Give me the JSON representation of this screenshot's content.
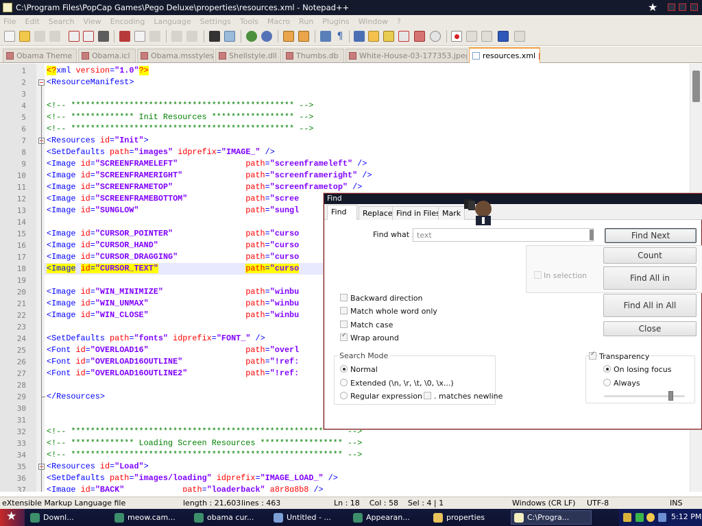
{
  "window": {
    "title": "C:\\Program Files\\PopCap Games\\Pego Deluxe\\properties\\resources.xml - Notepad++"
  },
  "menu": [
    "File",
    "Edit",
    "Search",
    "View",
    "Encoding",
    "Language",
    "Settings",
    "Tools",
    "Macro",
    "Run",
    "Plugins",
    "Window",
    "?"
  ],
  "tabs": [
    "Obama Theme",
    "Obama.icl",
    "Obama.msstyles",
    "Shellstyle.dll",
    "Thumbs.db",
    "White-House-03-177353.jpeg",
    "resources.xml"
  ],
  "active_tab": "resources.xml",
  "editor": {
    "lines": [
      {
        "n": "1",
        "segs": [
          [
            "pi",
            "<?"
          ],
          [
            "tag",
            "xml "
          ],
          [
            "attr",
            "version"
          ],
          [
            "tag",
            "="
          ],
          [
            "val",
            "\"1.0\""
          ],
          [
            "pi",
            "?>"
          ]
        ]
      },
      {
        "n": "2",
        "segs": [
          [
            "tag",
            "<ResourceManifest>"
          ]
        ]
      },
      {
        "n": "3",
        "segs": []
      },
      {
        "n": "4",
        "segs": [
          [
            "com",
            "<!-- ********************************************** -->"
          ]
        ]
      },
      {
        "n": "5",
        "segs": [
          [
            "com",
            "<!-- ************* Init Resources ***************** -->"
          ]
        ]
      },
      {
        "n": "6",
        "segs": [
          [
            "com",
            "<!-- ********************************************** -->"
          ]
        ]
      },
      {
        "n": "7",
        "segs": [
          [
            "tag",
            "<Resources "
          ],
          [
            "attr",
            "id"
          ],
          [
            "tag",
            "="
          ],
          [
            "val",
            "\"Init\""
          ],
          [
            "tag",
            ">"
          ]
        ]
      },
      {
        "n": "8",
        "segs": [
          [
            "tag",
            "<SetDefaults "
          ],
          [
            "attr",
            "path"
          ],
          [
            "tag",
            "="
          ],
          [
            "val",
            "\"images\""
          ],
          [
            "tag",
            " "
          ],
          [
            "attr",
            "idprefix"
          ],
          [
            "tag",
            "="
          ],
          [
            "val",
            "\"IMAGE_\""
          ],
          [
            "tag",
            " />"
          ]
        ]
      },
      {
        "n": "9",
        "segs": [
          [
            "tag",
            "<Image "
          ],
          [
            "attr",
            "id"
          ],
          [
            "tag",
            "="
          ],
          [
            "val",
            "\"SCREENFRAMELEFT\""
          ],
          [
            "tag",
            "              "
          ],
          [
            "attr",
            "path"
          ],
          [
            "tag",
            "="
          ],
          [
            "val",
            "\"screenframeleft\""
          ],
          [
            "tag",
            " />"
          ]
        ]
      },
      {
        "n": "10",
        "segs": [
          [
            "tag",
            "<Image "
          ],
          [
            "attr",
            "id"
          ],
          [
            "tag",
            "="
          ],
          [
            "val",
            "\"SCREENFRAMERIGHT\""
          ],
          [
            "tag",
            "             "
          ],
          [
            "attr",
            "path"
          ],
          [
            "tag",
            "="
          ],
          [
            "val",
            "\"screenframeright\""
          ],
          [
            "tag",
            " />"
          ]
        ]
      },
      {
        "n": "11",
        "segs": [
          [
            "tag",
            "<Image "
          ],
          [
            "attr",
            "id"
          ],
          [
            "tag",
            "="
          ],
          [
            "val",
            "\"SCREENFRAMETOP\""
          ],
          [
            "tag",
            "               "
          ],
          [
            "attr",
            "path"
          ],
          [
            "tag",
            "="
          ],
          [
            "val",
            "\"screenframetop\""
          ],
          [
            "tag",
            " />"
          ]
        ]
      },
      {
        "n": "12",
        "segs": [
          [
            "tag",
            "<Image "
          ],
          [
            "attr",
            "id"
          ],
          [
            "tag",
            "="
          ],
          [
            "val",
            "\"SCREENFRAMEBOTTOM\""
          ],
          [
            "tag",
            "            "
          ],
          [
            "attr",
            "path"
          ],
          [
            "tag",
            "="
          ],
          [
            "val",
            "\"scree"
          ]
        ]
      },
      {
        "n": "13",
        "segs": [
          [
            "tag",
            "<Image "
          ],
          [
            "attr",
            "id"
          ],
          [
            "tag",
            "="
          ],
          [
            "val",
            "\"SUNGLOW\""
          ],
          [
            "tag",
            "                      "
          ],
          [
            "attr",
            "path"
          ],
          [
            "tag",
            "="
          ],
          [
            "val",
            "\"sungl"
          ]
        ]
      },
      {
        "n": "14",
        "segs": []
      },
      {
        "n": "15",
        "segs": [
          [
            "tag",
            "<Image "
          ],
          [
            "attr",
            "id"
          ],
          [
            "tag",
            "="
          ],
          [
            "val",
            "\"CURSOR_POINTER\""
          ],
          [
            "tag",
            "               "
          ],
          [
            "attr",
            "path"
          ],
          [
            "tag",
            "="
          ],
          [
            "val",
            "\"curso"
          ]
        ]
      },
      {
        "n": "16",
        "segs": [
          [
            "tag",
            "<Image "
          ],
          [
            "attr",
            "id"
          ],
          [
            "tag",
            "="
          ],
          [
            "val",
            "\"CURSOR_HAND\""
          ],
          [
            "tag",
            "                  "
          ],
          [
            "attr",
            "path"
          ],
          [
            "tag",
            "="
          ],
          [
            "val",
            "\"curso"
          ]
        ]
      },
      {
        "n": "17",
        "segs": [
          [
            "tag",
            "<Image "
          ],
          [
            "attr",
            "id"
          ],
          [
            "tag",
            "="
          ],
          [
            "val",
            "\"CURSOR_DRAGGING\""
          ],
          [
            "tag",
            "              "
          ],
          [
            "attr",
            "path"
          ],
          [
            "tag",
            "="
          ],
          [
            "val",
            "\"curso"
          ]
        ]
      },
      {
        "n": "18",
        "hl": true,
        "segs": [
          [
            "tagh",
            "<Image"
          ],
          [
            "tag",
            " "
          ],
          [
            "attrh",
            "id"
          ],
          [
            "tagh",
            "="
          ],
          [
            "valh",
            "\"CURSOR_TEXT\""
          ],
          [
            "tag",
            "                  "
          ],
          [
            "attrh",
            "path"
          ],
          [
            "tagh",
            "="
          ],
          [
            "valh",
            "\"curso"
          ]
        ]
      },
      {
        "n": "19",
        "segs": []
      },
      {
        "n": "20",
        "segs": [
          [
            "tag",
            "<Image "
          ],
          [
            "attr",
            "id"
          ],
          [
            "tag",
            "="
          ],
          [
            "val",
            "\"WIN_MINIMIZE\""
          ],
          [
            "tag",
            "                 "
          ],
          [
            "attr",
            "path"
          ],
          [
            "tag",
            "="
          ],
          [
            "val",
            "\"winbu"
          ]
        ]
      },
      {
        "n": "21",
        "segs": [
          [
            "tag",
            "<Image "
          ],
          [
            "attr",
            "id"
          ],
          [
            "tag",
            "="
          ],
          [
            "val",
            "\"WIN_UNMAX\""
          ],
          [
            "tag",
            "                    "
          ],
          [
            "attr",
            "path"
          ],
          [
            "tag",
            "="
          ],
          [
            "val",
            "\"winbu"
          ]
        ]
      },
      {
        "n": "22",
        "segs": [
          [
            "tag",
            "<Image "
          ],
          [
            "attr",
            "id"
          ],
          [
            "tag",
            "="
          ],
          [
            "val",
            "\"WIN_CLOSE\""
          ],
          [
            "tag",
            "                    "
          ],
          [
            "attr",
            "path"
          ],
          [
            "tag",
            "="
          ],
          [
            "val",
            "\"winbu"
          ]
        ]
      },
      {
        "n": "23",
        "segs": []
      },
      {
        "n": "24",
        "segs": [
          [
            "tag",
            "<SetDefaults "
          ],
          [
            "attr",
            "path"
          ],
          [
            "tag",
            "="
          ],
          [
            "val",
            "\"fonts\""
          ],
          [
            "tag",
            " "
          ],
          [
            "attr",
            "idprefix"
          ],
          [
            "tag",
            "="
          ],
          [
            "val",
            "\"FONT_\""
          ],
          [
            "tag",
            " />"
          ]
        ]
      },
      {
        "n": "25",
        "segs": [
          [
            "tag",
            "<Font "
          ],
          [
            "attr",
            "id"
          ],
          [
            "tag",
            "="
          ],
          [
            "val",
            "\"OVERLOAD16\""
          ],
          [
            "tag",
            "                    "
          ],
          [
            "attr",
            "path"
          ],
          [
            "tag",
            "="
          ],
          [
            "val",
            "\"overl"
          ]
        ]
      },
      {
        "n": "26",
        "segs": [
          [
            "tag",
            "<Font "
          ],
          [
            "attr",
            "id"
          ],
          [
            "tag",
            "="
          ],
          [
            "val",
            "\"OVERLOAD16OUTLINE\""
          ],
          [
            "tag",
            "             "
          ],
          [
            "attr",
            "path"
          ],
          [
            "tag",
            "="
          ],
          [
            "val",
            "\"!ref:"
          ]
        ]
      },
      {
        "n": "27",
        "segs": [
          [
            "tag",
            "<Font "
          ],
          [
            "attr",
            "id"
          ],
          [
            "tag",
            "="
          ],
          [
            "val",
            "\"OVERLOAD16OUTLINE2\""
          ],
          [
            "tag",
            "            "
          ],
          [
            "attr",
            "path"
          ],
          [
            "tag",
            "="
          ],
          [
            "val",
            "\"!ref:"
          ]
        ]
      },
      {
        "n": "28",
        "segs": []
      },
      {
        "n": "29",
        "segs": [
          [
            "tag",
            "</Resources>"
          ]
        ]
      },
      {
        "n": "30",
        "segs": []
      },
      {
        "n": "31",
        "segs": []
      },
      {
        "n": "32",
        "segs": [
          [
            "com",
            "<!-- ******************************************************** -->"
          ]
        ]
      },
      {
        "n": "33",
        "segs": [
          [
            "com",
            "<!-- ************* Loading Screen Resources ***************** -->"
          ]
        ]
      },
      {
        "n": "34",
        "segs": [
          [
            "com",
            "<!-- ******************************************************** -->"
          ]
        ]
      },
      {
        "n": "35",
        "segs": [
          [
            "tag",
            "<Resources "
          ],
          [
            "attr",
            "id"
          ],
          [
            "tag",
            "="
          ],
          [
            "val",
            "\"Load\""
          ],
          [
            "tag",
            ">"
          ]
        ]
      },
      {
        "n": "36",
        "segs": [
          [
            "tag",
            "<SetDefaults "
          ],
          [
            "attr",
            "path"
          ],
          [
            "tag",
            "="
          ],
          [
            "val",
            "\"images/loading\""
          ],
          [
            "tag",
            " "
          ],
          [
            "attr",
            "idprefix"
          ],
          [
            "tag",
            "="
          ],
          [
            "val",
            "\"IMAGE_LOAD_\""
          ],
          [
            "tag",
            " />"
          ]
        ]
      },
      {
        "n": "37",
        "segs": [
          [
            "tag",
            "<Image "
          ],
          [
            "attr",
            "id"
          ],
          [
            "tag",
            "="
          ],
          [
            "val",
            "\"BACK\""
          ],
          [
            "tag",
            "            "
          ],
          [
            "attr",
            "path"
          ],
          [
            "tag",
            "="
          ],
          [
            "val",
            "\"loaderback\""
          ],
          [
            "tag",
            " "
          ],
          [
            "attr",
            "a8r8g8b8"
          ],
          [
            "tag",
            " />"
          ]
        ]
      }
    ]
  },
  "find_dialog": {
    "title": "Find",
    "tabs": [
      "Find",
      "Replace",
      "Find in Files",
      "Mark"
    ],
    "find_what_label": "Find what :",
    "find_what_value": "text",
    "buttons": {
      "find_next": "Find Next",
      "count": "Count",
      "find_all_in": "Find All in",
      "find_all_in_all": "Find All in All",
      "close": "Close"
    },
    "in_selection": "In selection",
    "checkboxes": {
      "backward": {
        "label": "Backward direction",
        "checked": false
      },
      "whole_word": {
        "label": "Match whole word only",
        "checked": false
      },
      "match_case": {
        "label": "Match case",
        "checked": false
      },
      "wrap_around": {
        "label": "Wrap around",
        "checked": true
      }
    },
    "search_mode": {
      "label": "Search Mode",
      "normal": "Normal",
      "extended": "Extended (\\n, \\r, \\t, \\0, \\x...)",
      "regex": "Regular expression",
      "matches_newline": ". matches newline",
      "selected": "normal"
    },
    "transparency": {
      "label": "Transparency",
      "enabled": true,
      "on_losing_focus": "On losing focus",
      "always": "Always",
      "selected": "on_losing_focus",
      "level": 0.85
    }
  },
  "status": {
    "file_type": "eXtensible Markup Language file",
    "length": "length : 21,603",
    "lines": "lines : 463",
    "position": "Ln : 18    Col : 58    Sel : 4 | 1",
    "eol": "Windows (CR LF)",
    "encoding": "UTF-8",
    "mode": "INS"
  },
  "taskbar": {
    "items": [
      "Downl...",
      "meow.cam...",
      "obama cur...",
      "Untitled - ...",
      "Appearan...",
      "properties",
      "C:\\Progra..."
    ],
    "clock": "5:12 PM"
  },
  "colors": {
    "tag": "#0000ff",
    "attribute": "#ff0000",
    "value": "#8000ff",
    "comment": "#008000",
    "accent_tab": "#f2a141",
    "titlebar": "#141a2c"
  }
}
